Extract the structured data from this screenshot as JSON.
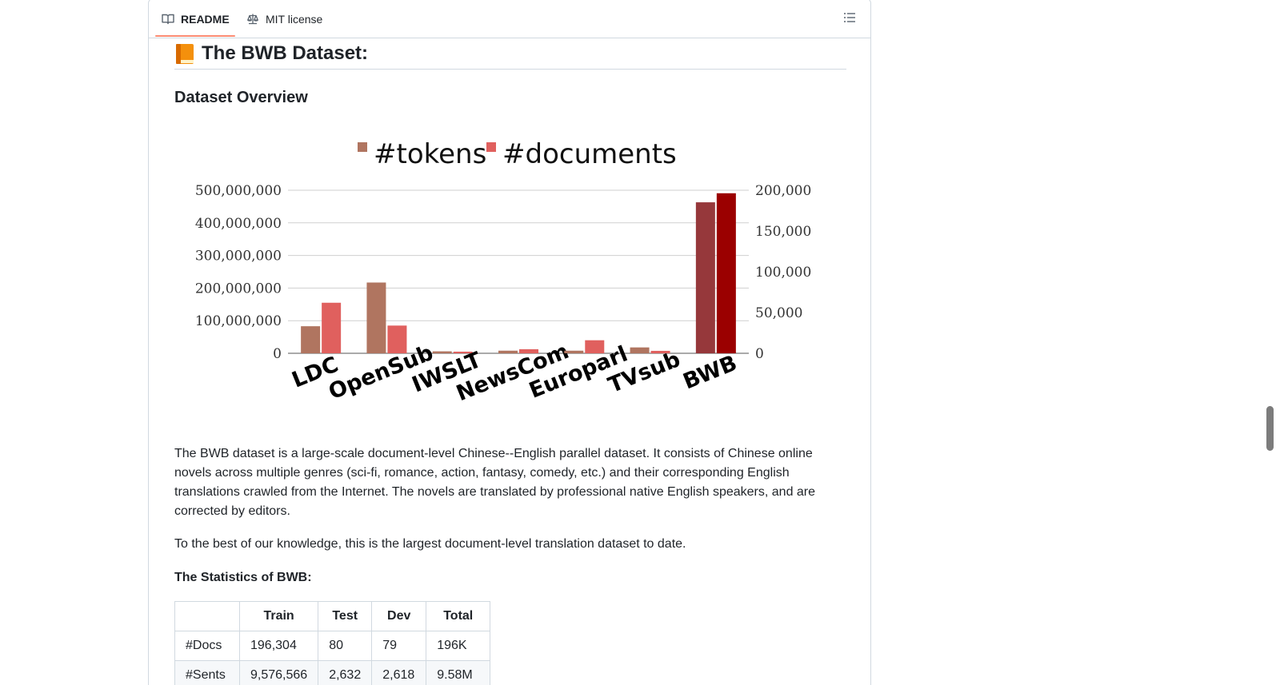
{
  "tabs": [
    {
      "label": "README",
      "icon": "book-icon"
    },
    {
      "label": "MIT license",
      "icon": "law-icon"
    }
  ],
  "heading": "The BWB Dataset:",
  "subheading": "Dataset Overview",
  "chart_data": {
    "type": "bar",
    "categories": [
      "LDC",
      "OpenSub",
      "IWSLT",
      "NewsCom",
      "Europarl",
      "TVsub",
      "BWB"
    ],
    "series": [
      {
        "name": "#tokens",
        "axis": "left",
        "color": "#b07560",
        "highlight_color": "#96383b",
        "values": [
          83000000,
          217000000,
          6000000,
          8000000,
          8000000,
          18000000,
          463000000
        ]
      },
      {
        "name": "#documents",
        "axis": "right",
        "color": "#e0605e",
        "highlight_color": "#9b0000",
        "values": [
          62000,
          34000,
          2000,
          5000,
          16000,
          3000,
          196304
        ]
      }
    ],
    "left_ticks": [
      "0",
      "100,000,000",
      "200,000,000",
      "300,000,000",
      "400,000,000",
      "500,000,000"
    ],
    "right_ticks": [
      "0",
      "50,000",
      "100,000",
      "150,000",
      "200,000"
    ],
    "ylim_left": [
      0,
      500000000
    ],
    "ylim_right": [
      0,
      200000
    ],
    "legend_position": "top-center",
    "grid": true
  },
  "paragraphs": [
    "The BWB dataset is a large-scale document-level Chinese--English parallel dataset. It consists of Chinese online novels across multiple genres (sci-fi, romance, action, fantasy, comedy, etc.) and their corresponding English translations crawled from the Internet. The novels are translated by professional native English speakers, and are corrected by editors.",
    "To the best of our knowledge, this is the largest document-level translation dataset to date."
  ],
  "stats_title": "The Statistics of BWB:",
  "stats_table": {
    "headers": [
      "",
      "Train",
      "Test",
      "Dev",
      "Total"
    ],
    "rows": [
      [
        "#Docs",
        "196,304",
        "80",
        "79",
        "196K"
      ],
      [
        "#Sents",
        "9,576,566",
        "2,632",
        "2,618",
        "9.58M"
      ]
    ]
  }
}
